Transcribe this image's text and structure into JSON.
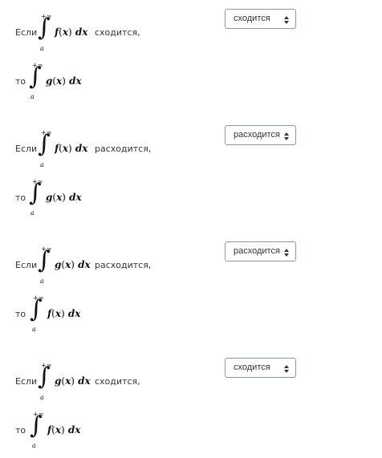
{
  "questions": [
    {
      "line1": {
        "prefix": "Если",
        "upper": "+∞",
        "lower": "a",
        "func": "f",
        "var": "x",
        "dx": "dx",
        "suffix": "сходится,"
      },
      "line2": {
        "prefix": "то",
        "upper": "+∞",
        "lower": "a",
        "func": "g",
        "var": "x",
        "dx": "dx"
      },
      "select": {
        "value": "сходится",
        "icon": "sort-updown-icon"
      }
    },
    {
      "line1": {
        "prefix": "Если",
        "upper": "+∞",
        "lower": "a",
        "func": "f",
        "var": "x",
        "dx": "dx",
        "suffix": "расходится,"
      },
      "line2": {
        "prefix": "то",
        "upper": "+∞",
        "lower": "a",
        "func": "g",
        "var": "x",
        "dx": "dx"
      },
      "select": {
        "value": "расходится",
        "icon": "sort-updown-icon"
      }
    },
    {
      "line1": {
        "prefix": "Если",
        "upper": "+∞",
        "lower": "a",
        "func": "g",
        "var": "x",
        "dx": "dx",
        "suffix": "расходится,"
      },
      "line2": {
        "prefix": "то",
        "upper": "+∞",
        "lower": "a",
        "func": "f",
        "var": "x",
        "dx": "dx"
      },
      "select": {
        "value": "расходится",
        "icon": "sort-updown-icon"
      }
    },
    {
      "line1": {
        "prefix": "Если",
        "upper": "+∞",
        "lower": "a",
        "func": "g",
        "var": "x",
        "dx": "dx",
        "suffix": "сходится,"
      },
      "line2": {
        "prefix": "то",
        "upper": "+∞",
        "lower": "a",
        "func": "f",
        "var": "x",
        "dx": "dx"
      },
      "select": {
        "value": "сходится",
        "icon": "sort-updown-icon"
      }
    }
  ],
  "symbols": {
    "integral": "∫",
    "open_paren": "(",
    "close_paren": ")"
  }
}
